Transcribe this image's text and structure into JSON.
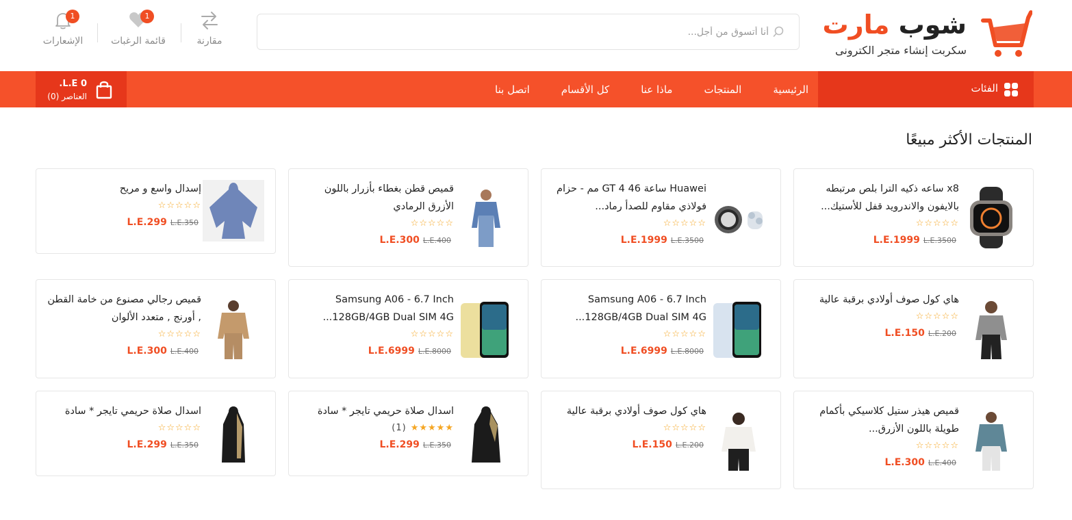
{
  "colors": {
    "accent": "#f04e23",
    "nav_bg": "#f5512a",
    "nav_dark": "#e6371b",
    "star": "#f5a623"
  },
  "brand": {
    "title_dark": "شوب",
    "title_accent": "مارت",
    "subtitle": "سكربت إنشاء متجر الكترونى"
  },
  "search": {
    "placeholder": "أنا أتسوق من أجل..."
  },
  "header_actions": {
    "compare": {
      "label": "مقارنة",
      "icon": "compare-icon"
    },
    "wishlist": {
      "label": "قائمة الرغبات",
      "badge": "1",
      "icon": "heart-icon"
    },
    "notifications": {
      "label": "الإشعارات",
      "badge": "1",
      "icon": "bell-icon"
    }
  },
  "nav": {
    "categories_label": "الفئات",
    "links": [
      "الرئيسية",
      "المنتجات",
      "ماذا عنا",
      "كل الأقسام",
      "اتصل بنا"
    ],
    "cart_amount": "0 L.E.",
    "cart_items": "العناصر (0)"
  },
  "section_title": "المنتجات الأكثر مبيعًا",
  "products": [
    {
      "title": "x8 ساعه ذكيه الترا بلص مرتبطه بالايفون والاندرويد قفل للأستيك...",
      "rating": 0,
      "price": "L.E.1999",
      "old_price": "L.E.3500",
      "image": "smartwatch-image"
    },
    {
      "title": "Huawei ساعة GT 4 46 مم - حزام فولاذي مقاوم للصدأ رماد...",
      "rating": 0,
      "price": "L.E.1999",
      "old_price": "L.E.3500",
      "image": "huawei-watch-image"
    },
    {
      "title": "قميص قطن بغطاء بأزرار باللون الأزرق الرمادي",
      "rating": 0,
      "price": "L.E.300",
      "old_price": "L.E.400",
      "image": "blue-shirt-image"
    },
    {
      "title": "إسدال واسع و مريح",
      "rating": 0,
      "price": "L.E.299",
      "old_price": "L.E.350",
      "image": "prayer-dress-image"
    },
    {
      "title": "هاي كول صوف أولادي برقبة عالية",
      "rating": 0,
      "price": "L.E.150",
      "old_price": "L.E.200",
      "image": "kids-sweater-grey-image"
    },
    {
      "title": "Samsung A06 - 6.7 Inch 128GB/4GB Dual SIM 4G...",
      "rating": 0,
      "price": "L.E.6999",
      "old_price": "L.E.8000",
      "image": "samsung-blue-image"
    },
    {
      "title": "Samsung A06 - 6.7 Inch 128GB/4GB Dual SIM 4G...",
      "rating": 0,
      "price": "L.E.6999",
      "old_price": "L.E.8000",
      "image": "samsung-gold-image"
    },
    {
      "title": "قميص رجالي مصنوع من خامة القطن , أورنج , متعدد الألوان",
      "rating": 0,
      "price": "L.E.300",
      "old_price": "L.E.400",
      "image": "checked-shirt-image"
    },
    {
      "title": "قميص هيذر ستيل كلاسيكي بأكمام طويلة باللون الأزرق...",
      "rating": 0,
      "price": "L.E.300",
      "old_price": "L.E.400",
      "image": "heather-shirt-image"
    },
    {
      "title": "هاي كول صوف أولادي برقبة عالية",
      "rating": 0,
      "price": "L.E.150",
      "old_price": "L.E.200",
      "image": "kids-sweater-white-image"
    },
    {
      "title": "اسدال صلاة حريمي تايجر * سادة",
      "rating": 5,
      "rating_count": "(1)",
      "price": "L.E.299",
      "old_price": "L.E.350",
      "image": "tiger-prayer-dress-image"
    },
    {
      "title": "اسدال صلاة حريمي تايجر * سادة",
      "rating": 0,
      "price": "L.E.299",
      "old_price": "L.E.350",
      "image": "tiger-prayer-dress-image-2"
    }
  ]
}
